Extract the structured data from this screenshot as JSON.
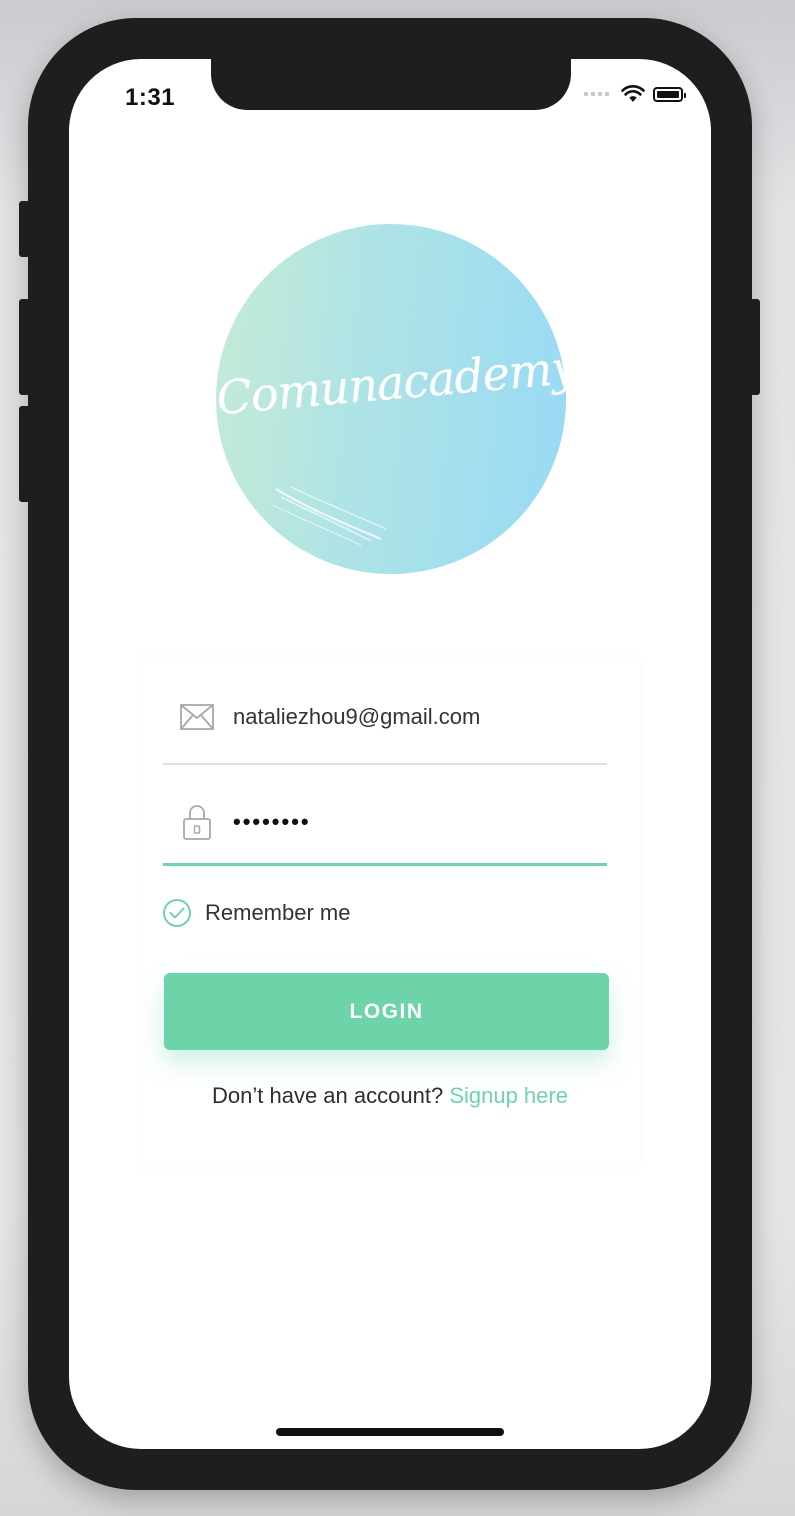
{
  "status_bar": {
    "time": "1:31",
    "icons": [
      "signal-dots-icon",
      "wifi-icon",
      "battery-icon"
    ]
  },
  "logo": {
    "text": "Comunacademy",
    "colors": [
      "#c6ebd6",
      "#97d9f6"
    ]
  },
  "form": {
    "email": {
      "icon": "envelope-icon",
      "value": "nataliezhou9@gmail.com"
    },
    "password": {
      "icon": "lock-icon",
      "value": "••••••••"
    },
    "remember": {
      "icon": "checkmark-circle-icon",
      "label": "Remember me",
      "checked": true
    },
    "login_label": "LOGIN",
    "signup": {
      "prompt": "Don’t have an account?",
      "link": "Signup here"
    }
  },
  "colors": {
    "accent": "#6dd3a9",
    "text": "#333333",
    "frame": "#1e1e1e"
  }
}
